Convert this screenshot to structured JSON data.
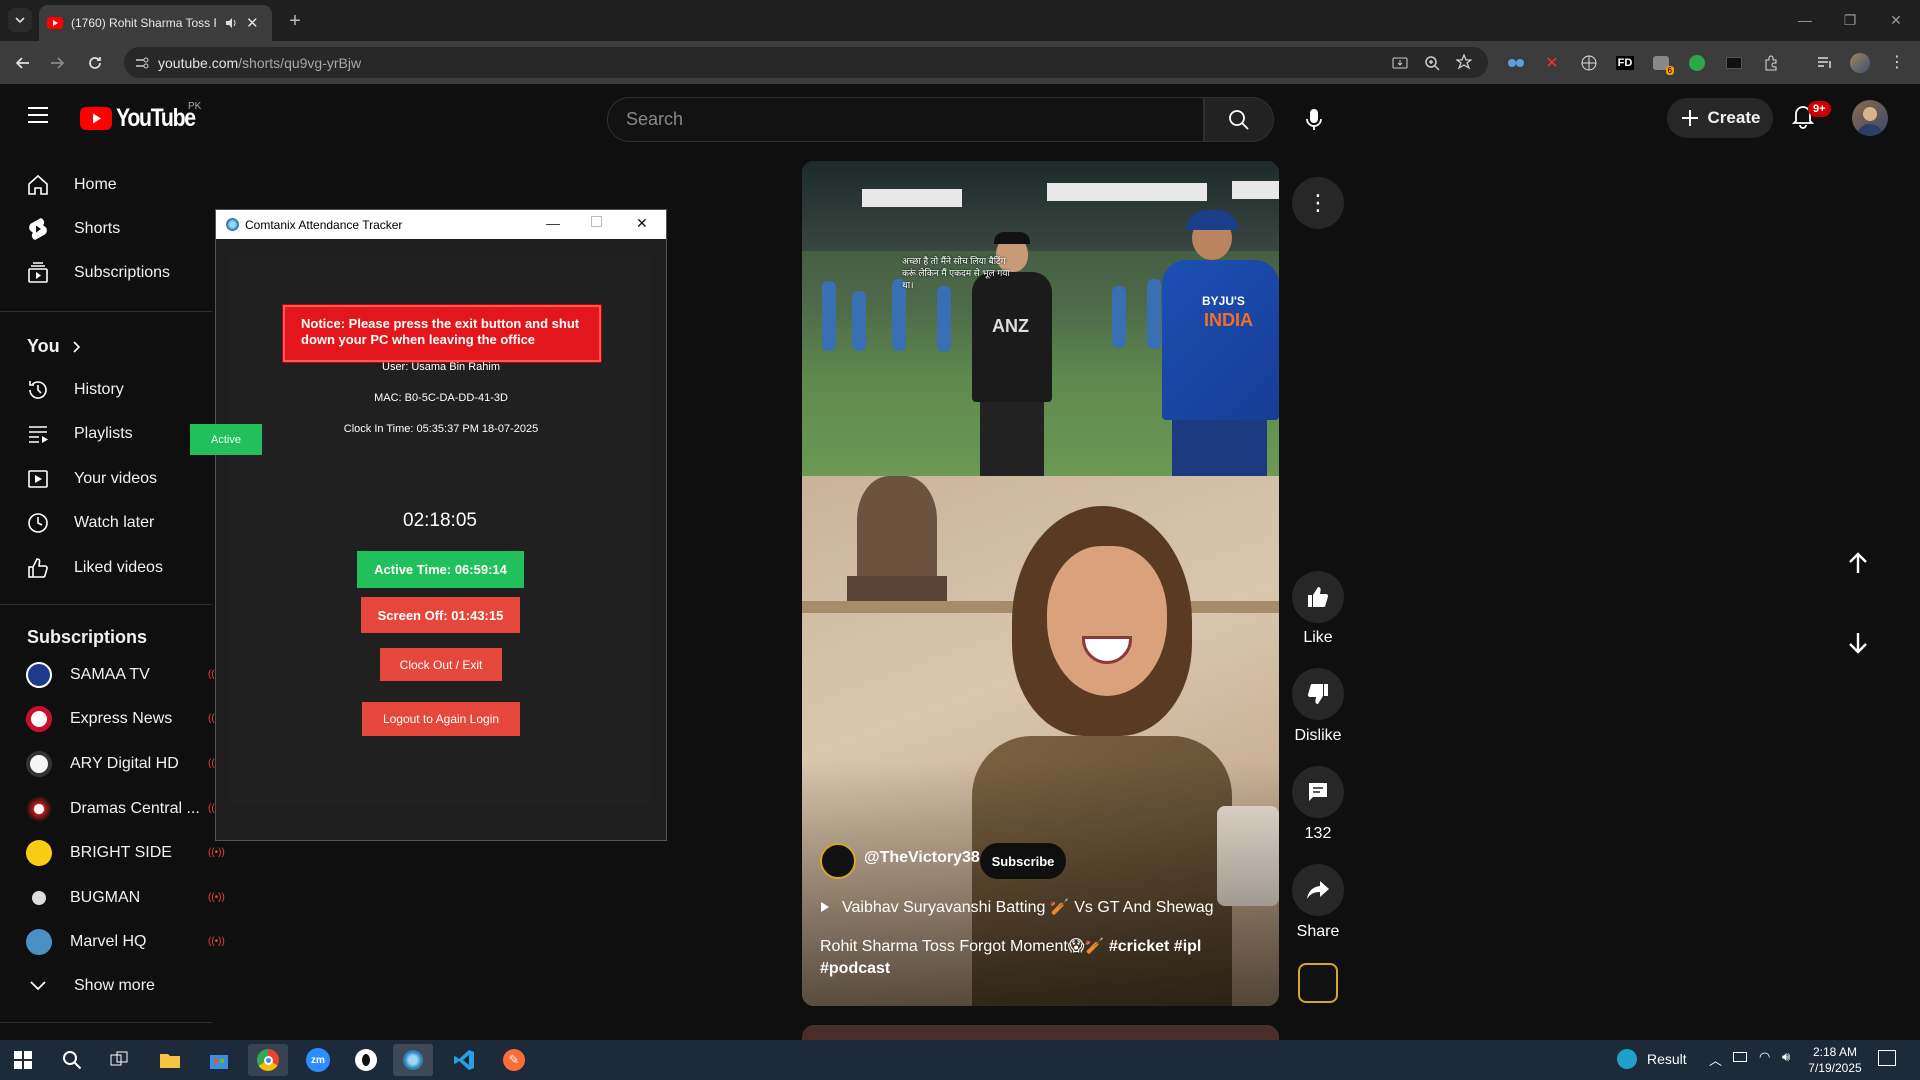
{
  "browser": {
    "tab_title": "(1760) Rohit Sharma Toss Fo",
    "url_host": "youtube.com",
    "url_path": "/shorts/qu9vg-yrBjw"
  },
  "header": {
    "brand": "YouTube",
    "country": "PK",
    "search_placeholder": "Search",
    "create_label": "Create",
    "notification_badge": "9+"
  },
  "sidebar": {
    "main": [
      {
        "label": "Home",
        "icon": "home-icon"
      },
      {
        "label": "Shorts",
        "icon": "shorts-icon"
      },
      {
        "label": "Subscriptions",
        "icon": "subscriptions-icon"
      }
    ],
    "you_title": "You",
    "you": [
      {
        "label": "History",
        "icon": "history-icon"
      },
      {
        "label": "Playlists",
        "icon": "playlists-icon"
      },
      {
        "label": "Your videos",
        "icon": "your-videos-icon"
      },
      {
        "label": "Watch later",
        "icon": "watch-later-icon"
      },
      {
        "label": "Liked videos",
        "icon": "liked-videos-icon"
      }
    ],
    "subscriptions_title": "Subscriptions",
    "subscriptions": [
      {
        "label": "SAMAA TV",
        "color": "#1e3a8a",
        "live": true
      },
      {
        "label": "Express News",
        "color": "#c8102e",
        "live": true
      },
      {
        "label": "ARY Digital HD",
        "color": "#f5f5f5",
        "live": true
      },
      {
        "label": "Dramas Central ...",
        "color": "#b91c1c",
        "live": true
      },
      {
        "label": "BRIGHT SIDE",
        "color": "#facc15",
        "live": true
      },
      {
        "label": "BUGMAN",
        "color": "#222222",
        "live": true
      },
      {
        "label": "Marvel HQ",
        "color": "#4a90c2",
        "live": true
      }
    ],
    "show_more": "Show more",
    "live_symbol": "((•))"
  },
  "attendance": {
    "window_title": "Comtanix Attendance Tracker",
    "notice": "Notice: Please press the exit button and shut down your PC when leaving the office",
    "user": "User: Usama Bin Rahim",
    "mac": "MAC: B0-5C-DA-DD-41-3D",
    "clock_in": "Clock In Time: 05:35:37 PM 18-07-2025",
    "status": "Active",
    "timer": "02:18:05",
    "active_time": "Active Time: 06:59:14",
    "screen_off": "Screen Off: 01:43:15",
    "clock_out": "Clock Out / Exit",
    "logout": "Logout to Again Login"
  },
  "video": {
    "caption_hindi": "अच्छा है तो मैंने सोच लिया बैटिंग करूं लेकिन मैं एकदम से भूल गया था।",
    "jersey_left": "ANZ",
    "jersey_right": "INDIA",
    "sponsor_right": "BYJU'S",
    "channel": "@TheVictory38",
    "subscribe": "Subscribe",
    "related": "Vaibhav Suryavanshi Batting 🏏 Vs GT And Shewag",
    "title": "Rohit Sharma Toss Forgot Moment😱🏏",
    "hashtags": "#cricket #ipl",
    "hashtag2": "#podcast",
    "like_label": "Like",
    "dislike_label": "Dislike",
    "comments_count": "132",
    "share_label": "Share"
  },
  "taskbar": {
    "weather": "Result",
    "time": "2:18 AM",
    "date": "7/19/2025"
  },
  "colors": {
    "yt_red": "#ff0000",
    "active_green": "#22c05c",
    "danger_red": "#e5473a",
    "notice_red": "#e3161b"
  }
}
